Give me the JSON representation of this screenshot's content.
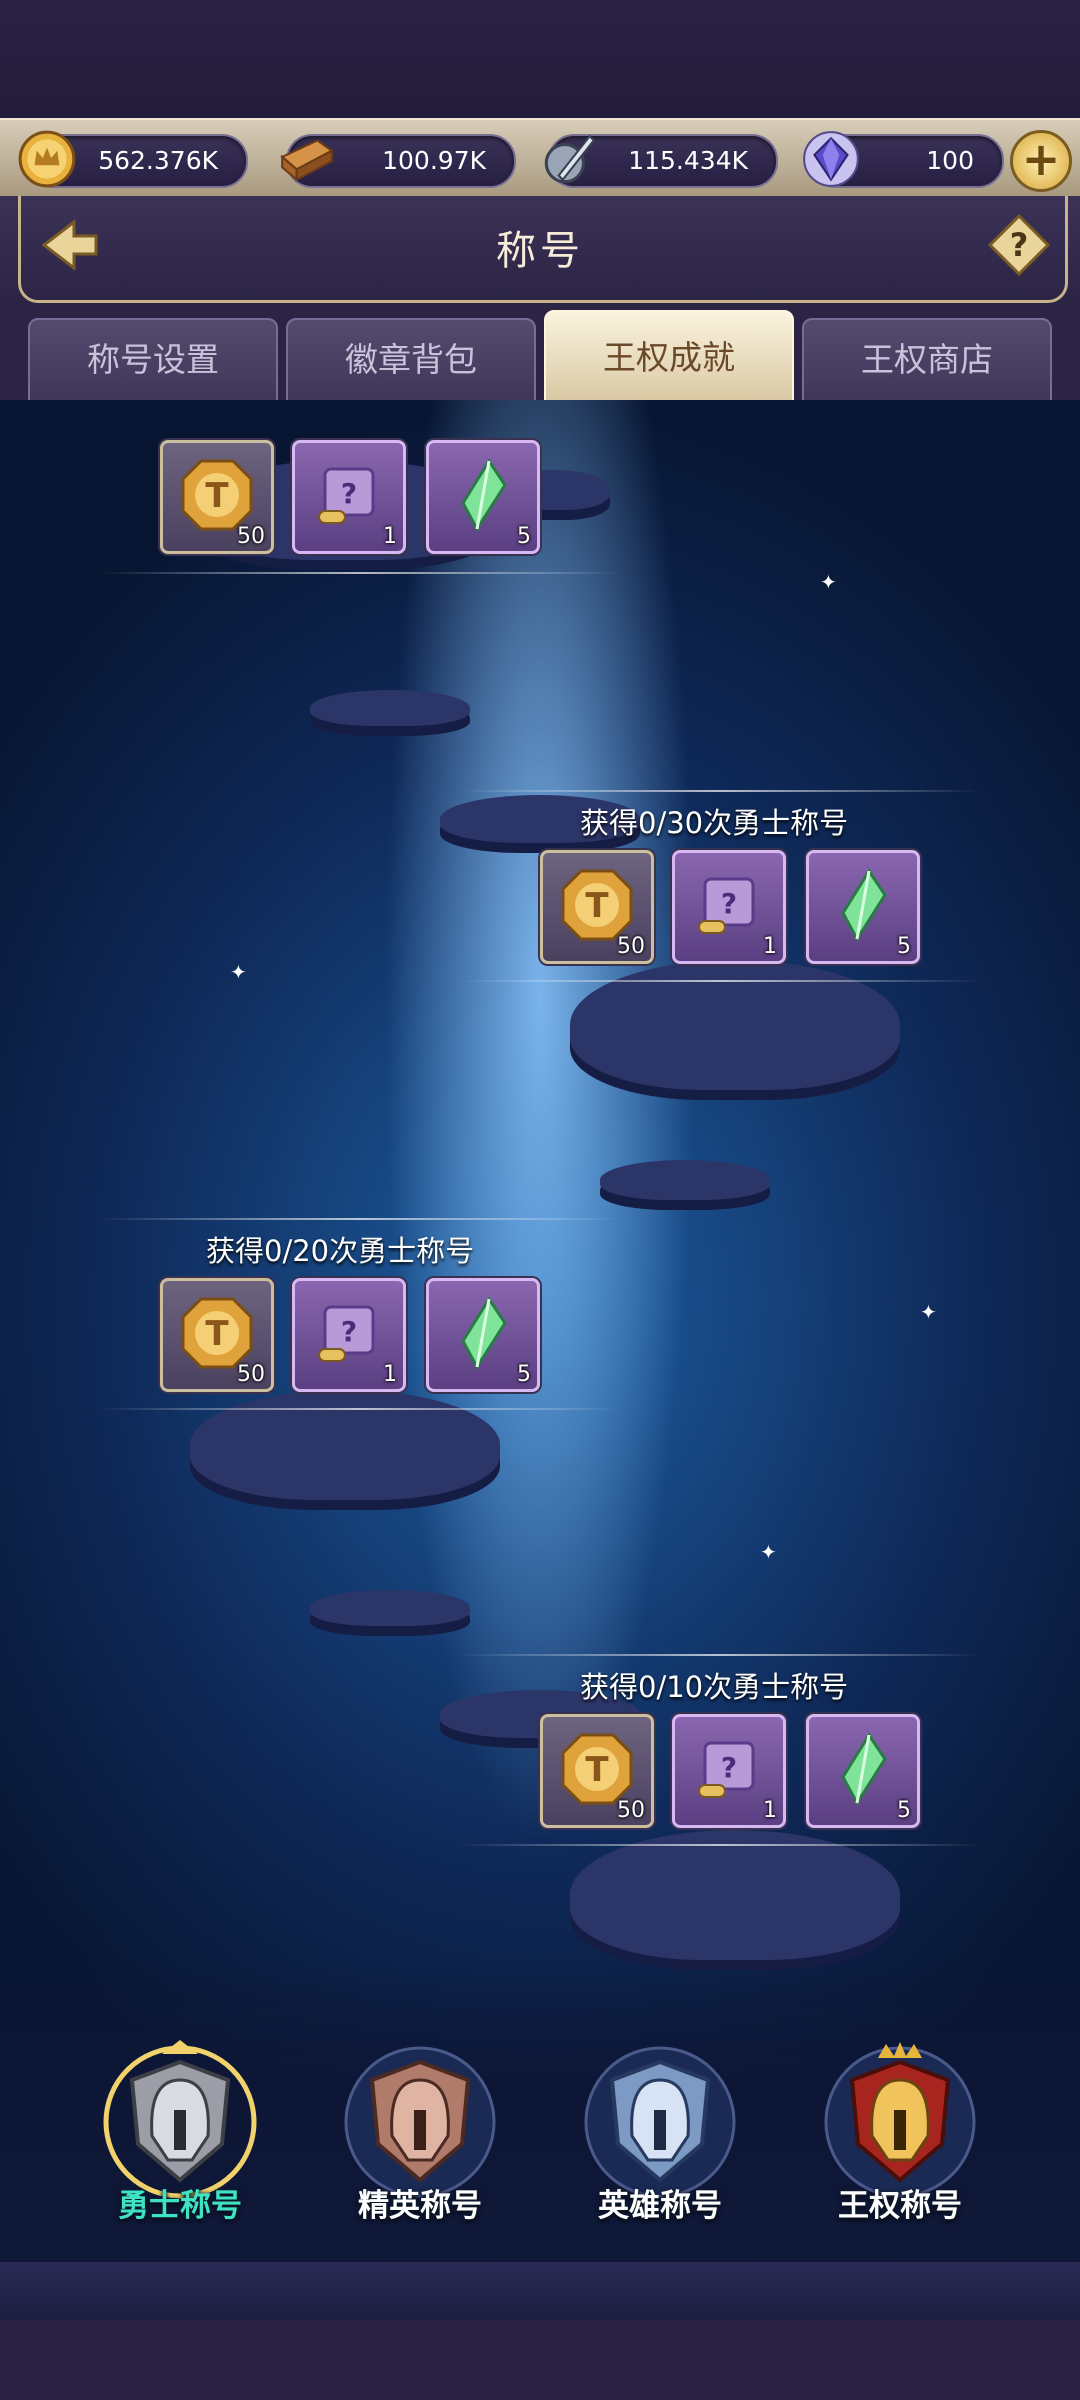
{
  "resources": [
    {
      "name": "gold",
      "value": "562.376K",
      "icon": "crown-coin-icon"
    },
    {
      "name": "wood",
      "value": "100.97K",
      "icon": "wood-log-icon"
    },
    {
      "name": "iron",
      "value": "115.434K",
      "icon": "sword-shield-icon"
    },
    {
      "name": "gem",
      "value": "100",
      "icon": "purple-gem-icon"
    }
  ],
  "header": {
    "title": "称号"
  },
  "tabs": [
    {
      "label": "称号设置",
      "active": false
    },
    {
      "label": "徽章背包",
      "active": false
    },
    {
      "label": "王权成就",
      "active": true
    },
    {
      "label": "王权商店",
      "active": false
    }
  ],
  "achievements": [
    {
      "label": "",
      "rewards": [
        {
          "icon": "t-coin-icon",
          "count": "50"
        },
        {
          "icon": "scroll-icon",
          "count": "1"
        },
        {
          "icon": "green-crystal-icon",
          "count": "5"
        }
      ]
    },
    {
      "label": "获得0/30次勇士称号",
      "rewards": [
        {
          "icon": "t-coin-icon",
          "count": "50"
        },
        {
          "icon": "scroll-icon",
          "count": "1"
        },
        {
          "icon": "green-crystal-icon",
          "count": "5"
        }
      ]
    },
    {
      "label": "获得0/20次勇士称号",
      "rewards": [
        {
          "icon": "t-coin-icon",
          "count": "50"
        },
        {
          "icon": "scroll-icon",
          "count": "1"
        },
        {
          "icon": "green-crystal-icon",
          "count": "5"
        }
      ]
    },
    {
      "label": "获得0/10次勇士称号",
      "rewards": [
        {
          "icon": "t-coin-icon",
          "count": "50"
        },
        {
          "icon": "scroll-icon",
          "count": "1"
        },
        {
          "icon": "green-crystal-icon",
          "count": "5"
        }
      ]
    }
  ],
  "ranks": [
    {
      "label": "勇士称号",
      "selected": true,
      "color": "#3ee3c3"
    },
    {
      "label": "精英称号",
      "selected": false,
      "color": "#ffffff"
    },
    {
      "label": "英雄称号",
      "selected": false,
      "color": "#ffffff"
    },
    {
      "label": "王权称号",
      "selected": false,
      "color": "#ffffff"
    }
  ]
}
